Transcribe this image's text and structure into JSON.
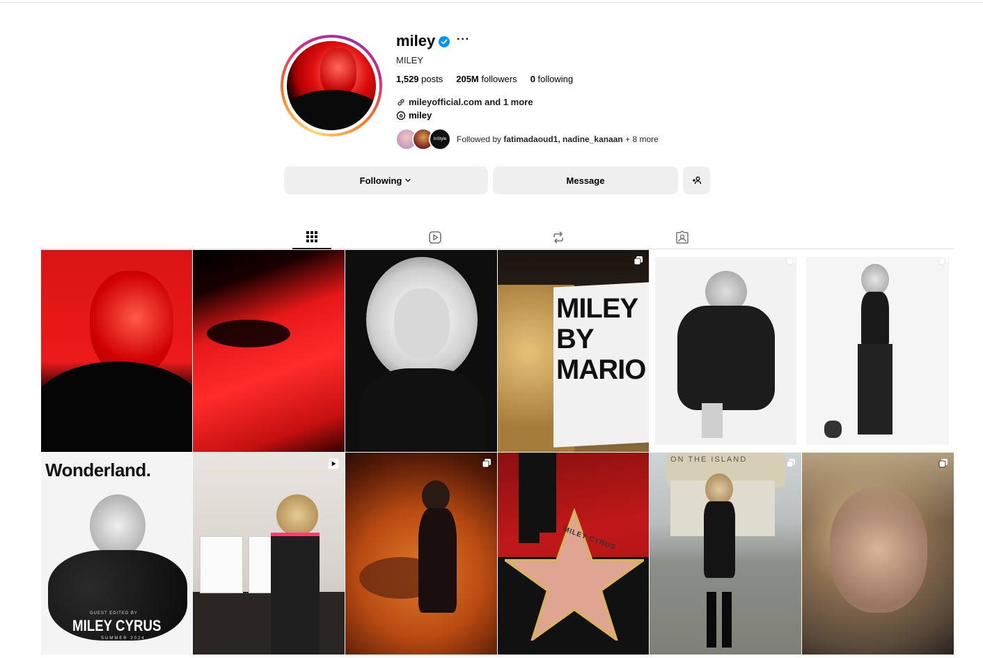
{
  "profile": {
    "username": "miley",
    "more": "···",
    "full_name": "MILEY",
    "posts_count": "1,529",
    "posts_label": " posts",
    "followers_count": "205M",
    "followers_label": " followers",
    "following_count": "0",
    "following_label": " following",
    "link_text": "mileyofficial.com and 1 more",
    "threads_handle": "miley",
    "followed_by_prefix": "Followed by ",
    "followed_by_names": "fatimadaoud1, nadine_kanaan",
    "followed_by_suffix": " + 8 more",
    "mini_avatar_3_text": "InStyle"
  },
  "actions": {
    "following_label": "Following",
    "message_label": "Message"
  },
  "tabs": [
    {
      "name": "posts",
      "icon": "grid-icon",
      "active": true
    },
    {
      "name": "reels",
      "icon": "reels-icon",
      "active": false
    },
    {
      "name": "reposts",
      "icon": "repost-icon",
      "active": false
    },
    {
      "name": "tagged",
      "icon": "tagged-icon",
      "active": false
    }
  ],
  "posts": [
    {
      "id": 1,
      "desc": "red portrait",
      "badge": null
    },
    {
      "id": 2,
      "desc": "red eye close-up",
      "badge": null
    },
    {
      "id": 3,
      "desc": "black and white portrait",
      "badge": null
    },
    {
      "id": 4,
      "desc": "magazine kiss",
      "badge": "carousel-icon",
      "overlay_text": "MILEY BY MARIO"
    },
    {
      "id": 5,
      "desc": "leather jacket",
      "badge": "carousel-icon"
    },
    {
      "id": 6,
      "desc": "black outfit full body",
      "badge": "carousel-icon"
    },
    {
      "id": 7,
      "desc": "Wonderland cover",
      "badge": null,
      "title": "Wonderland.",
      "cover_small": "GUEST EDITED BY",
      "cover_name": "MILEY CYRUS",
      "cover_issue": "SUMMER 2024"
    },
    {
      "id": 8,
      "desc": "dolls display",
      "badge": "reel-icon"
    },
    {
      "id": 9,
      "desc": "doll on stage",
      "badge": "carousel-icon"
    },
    {
      "id": 10,
      "desc": "walk of fame star",
      "badge": null,
      "star_text": "MILEY CYRUS"
    },
    {
      "id": 11,
      "desc": "leather dress outdoor",
      "badge": "carousel-icon",
      "sign_text": "ON THE ISLAND"
    },
    {
      "id": 12,
      "desc": "blurry portrait",
      "badge": "carousel-icon"
    }
  ],
  "colors": {
    "verified": "#0095f6",
    "button_bg": "#efefef"
  }
}
